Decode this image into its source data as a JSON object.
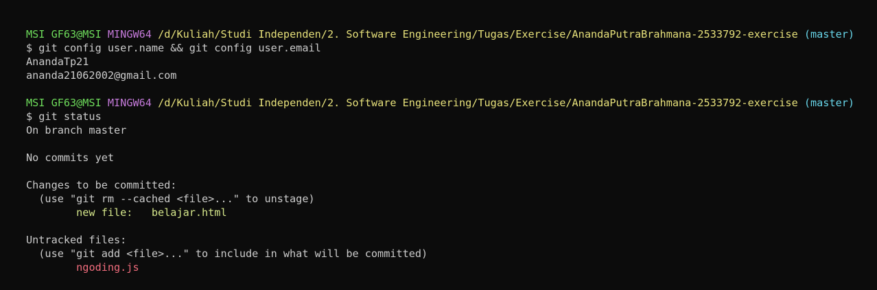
{
  "colors": {
    "background": "#0c0c0c",
    "text": "#cccccc",
    "user_host": "#6edc5b",
    "shell_name": "#c47ad9",
    "path": "#e6e07a",
    "branch": "#68d6ea",
    "staged_file": "#d4e58a",
    "untracked_file": "#f26d7d"
  },
  "prompt1": {
    "user_host": "MSI GF63@MSI",
    "shell": "MINGW64",
    "path": "/d/Kuliah/Studi Independen/2. Software Engineering/Tugas/Exercise/AnandaPutraBrahmana-2533792-exercise",
    "branch": "(master)",
    "command": "$ git config user.name && git config user.email"
  },
  "output1": {
    "user_name": "AnandaTp21",
    "user_email": "ananda21062002@gmail.com"
  },
  "prompt2": {
    "user_host": "MSI GF63@MSI",
    "shell": "MINGW64",
    "path": "/d/Kuliah/Studi Independen/2. Software Engineering/Tugas/Exercise/AnandaPutraBrahmana-2533792-exercise",
    "branch": "(master)",
    "command": "$ git status"
  },
  "status": {
    "branch_line": "On branch master",
    "no_commits": "No commits yet",
    "changes_header": "Changes to be committed:",
    "changes_hint": "  (use \"git rm --cached <file>...\" to unstage)",
    "staged_label": "        new file:   ",
    "staged_file": "belajar.html",
    "untracked_header": "Untracked files:",
    "untracked_hint": "  (use \"git add <file>...\" to include in what will be committed)",
    "untracked_indent": "        ",
    "untracked_file": "ngoding.js"
  }
}
